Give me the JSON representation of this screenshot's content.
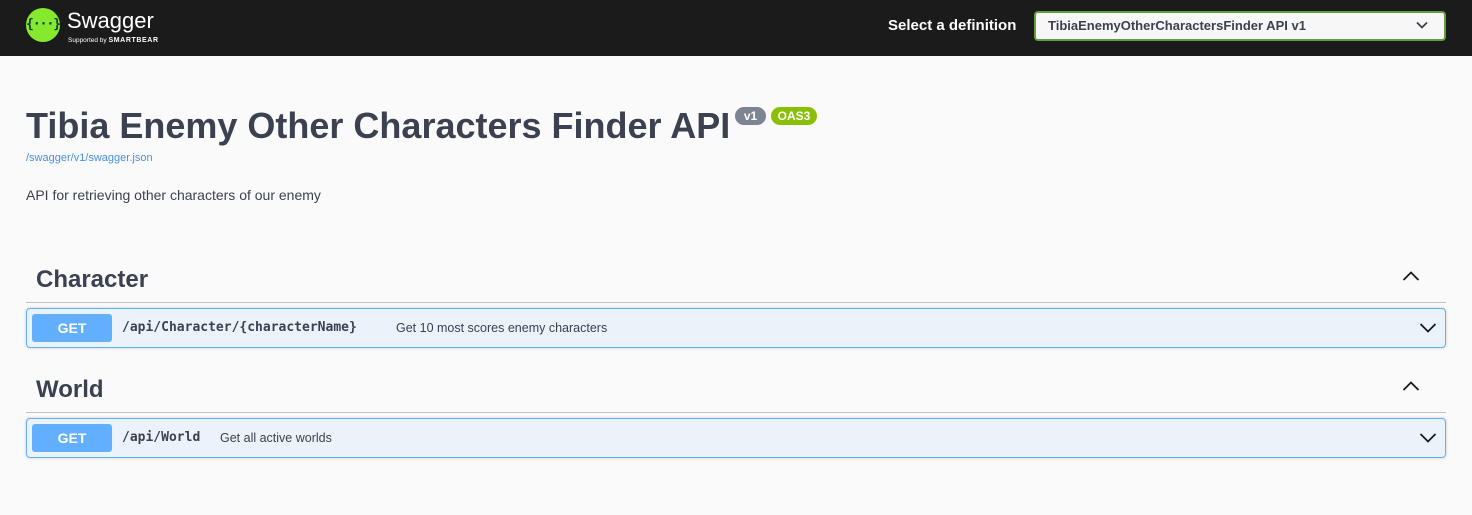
{
  "topbar": {
    "logo_glyph": "{···}",
    "logo_text": "Swagger",
    "logo_sub_prefix": "Supported by",
    "logo_sub_brand": "SMARTBEAR",
    "definition_label": "Select a definition",
    "definition_selected": "TibiaEnemyOtherCharactersFinder API v1"
  },
  "info": {
    "title": "Tibia Enemy Other Characters Finder API",
    "version_badge": "v1",
    "oas_badge": "OAS3",
    "spec_link": "/swagger/v1/swagger.json",
    "description": "API for retrieving other characters of our enemy"
  },
  "tags": [
    {
      "name": "Character",
      "operations": [
        {
          "method": "GET",
          "path": "/api/Character/{characterName}",
          "summary": "Get 10 most scores enemy characters"
        }
      ]
    },
    {
      "name": "World",
      "operations": [
        {
          "method": "GET",
          "path": "/api/World",
          "summary": "Get all active worlds"
        }
      ]
    }
  ],
  "colors": {
    "topbar_bg": "#1b1b1b",
    "logo_green": "#85ea2d",
    "select_border": "#62a03f",
    "get_blue": "#61affe",
    "version_badge": "#7d8492",
    "oas_badge": "#89bf04",
    "link": "#4990e2"
  },
  "icons": {
    "logo": "swagger-logo-icon",
    "select_chevron": "chevron-down-icon",
    "tag_collapse": "chevron-up-icon",
    "operation_expand": "chevron-down-icon"
  }
}
